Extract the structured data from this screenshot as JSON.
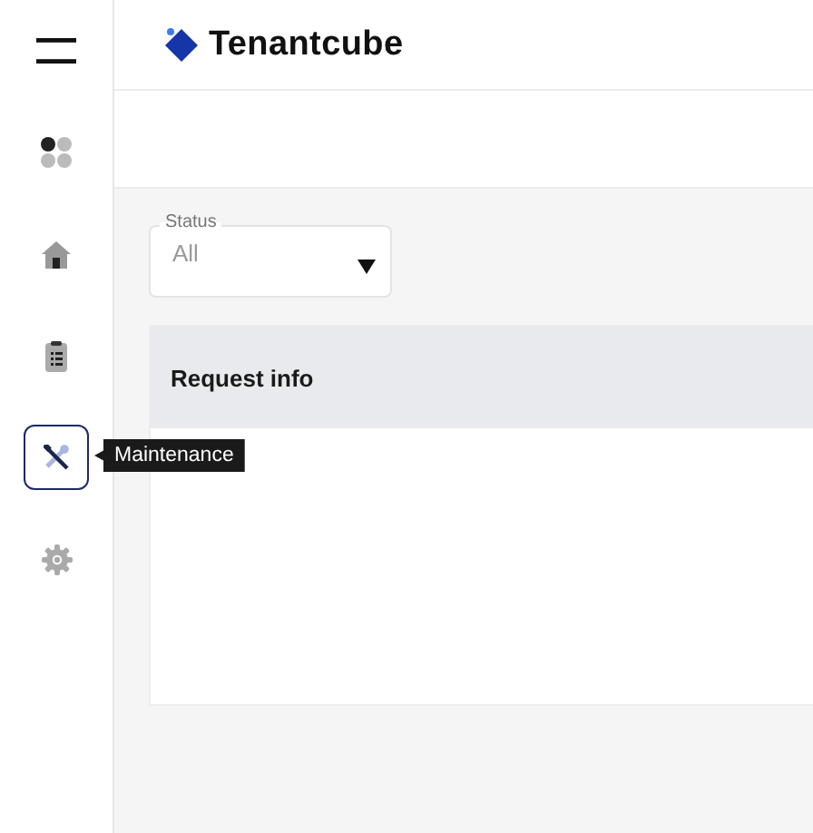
{
  "sidebar": {
    "items": [
      {
        "kind": "menu",
        "selected": false
      },
      {
        "kind": "dashboard",
        "selected": false
      },
      {
        "kind": "home",
        "selected": false
      },
      {
        "kind": "clipboard",
        "selected": false
      },
      {
        "kind": "tools",
        "selected": true
      },
      {
        "kind": "settings",
        "selected": false
      }
    ],
    "tooltip": "Maintenance"
  },
  "header": {
    "brand": "Tenantcube"
  },
  "filter": {
    "label": "Status",
    "value": "All"
  },
  "table": {
    "columns": [
      "Request info"
    ]
  }
}
